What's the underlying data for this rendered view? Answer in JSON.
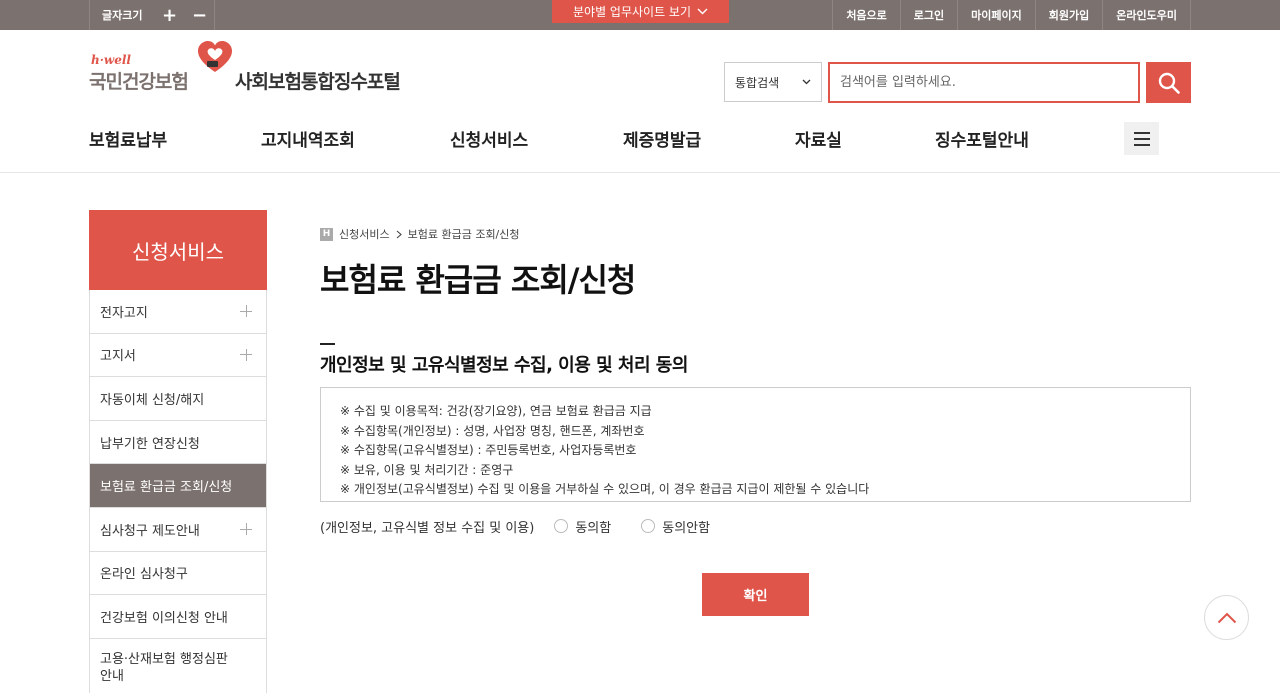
{
  "topbar": {
    "fontsize_label": "글자크기",
    "plus": "+",
    "minus": "−",
    "sites_label": "분야별 업무사이트 보기",
    "links": [
      "처음으로",
      "로그인",
      "마이페이지",
      "회원가입",
      "온라인도우미"
    ]
  },
  "header": {
    "logo_hwell": "h·well",
    "logo_nhis": "국민건강보험",
    "portal_name": "사회보험통합징수포털",
    "search_select": "통합검색",
    "search_placeholder": "검색어를 입력하세요."
  },
  "gnb": [
    "보험료납부",
    "고지내역조회",
    "신청서비스",
    "제증명발급",
    "자료실",
    "징수포털안내"
  ],
  "lnb": {
    "title": "신청서비스",
    "items": [
      {
        "label": "전자고지",
        "expand": true
      },
      {
        "label": "고지서",
        "expand": true
      },
      {
        "label": "자동이체 신청/해지",
        "expand": false
      },
      {
        "label": "납부기한 연장신청",
        "expand": false
      },
      {
        "label": "보험료 환급금 조회/신청",
        "expand": false,
        "active": true
      },
      {
        "label": "심사청구 제도안내",
        "expand": true
      },
      {
        "label": "온라인 심사청구",
        "expand": false
      },
      {
        "label": "건강보험 이의신청 안내",
        "expand": false
      },
      {
        "label": "고용·산재보험 행정심판 안내",
        "expand": false
      }
    ]
  },
  "breadcrumb": {
    "home": "H",
    "level1": "신청서비스",
    "level2": "보험료 환급금 조회/신청"
  },
  "page_title": "보험료 환급금 조회/신청",
  "section_title": "개인정보 및 고유식별정보 수집, 이용 및 처리 동의",
  "terms": [
    "※ 수집 및 이용목적: 건강(장기요양), 연금 보험료 환급금 지급",
    "※ 수집항목(개인정보) : 성명, 사업장 명칭, 핸드폰, 계좌번호",
    "※ 수집항목(고유식별정보) : 주민등록번호, 사업자등록번호",
    "※ 보유, 이용 및 처리기간 : 준영구",
    "※ 개인정보(고유식별정보) 수집 및 이용을 거부하실 수 있으며, 이 경우 환급금 지급이 제한될 수 있습니다"
  ],
  "agree": {
    "label": "(개인정보, 고유식별 정보 수집 및 이용)",
    "yes": "동의함",
    "no": "동의안함"
  },
  "confirm_label": "확인",
  "colors": {
    "accent": "#e0554a",
    "gray": "#7b716e"
  }
}
